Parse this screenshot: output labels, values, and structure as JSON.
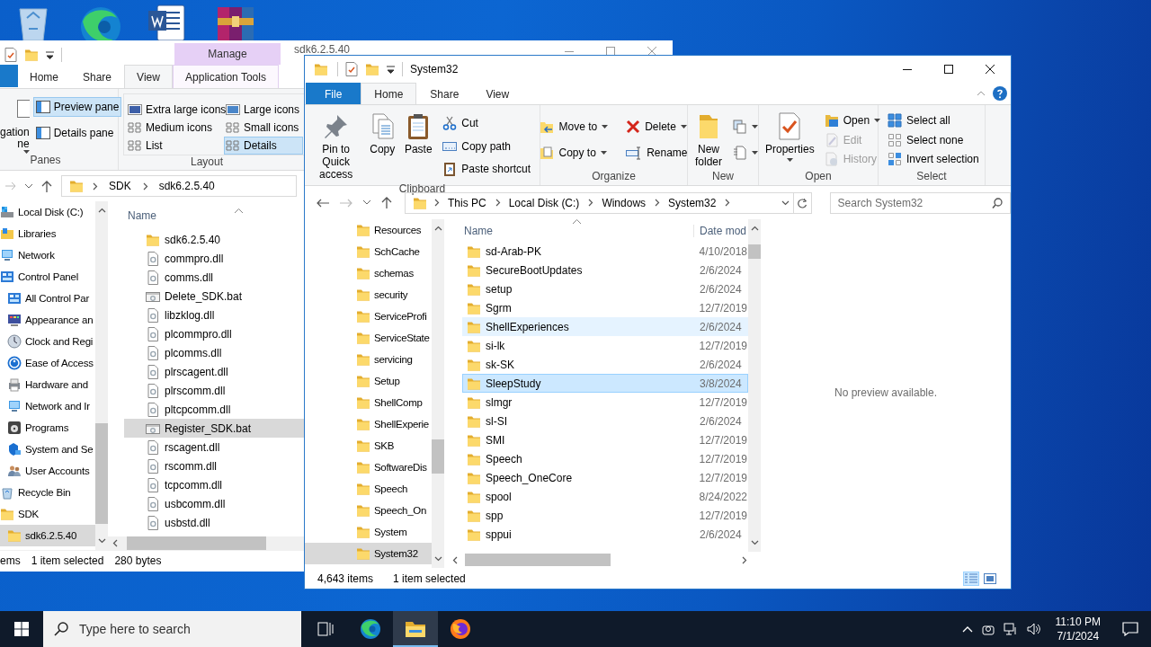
{
  "back_window": {
    "title": "sdk6.2.5.40",
    "context_group": "Manage",
    "tabs": [
      {
        "label": "Home",
        "selected": false
      },
      {
        "label": "Share",
        "selected": false
      },
      {
        "label": "View",
        "selected": true
      },
      {
        "label": "Application Tools",
        "selected": false
      }
    ],
    "panes": {
      "label": "Panes",
      "navigation_pane": [
        "gation",
        "ne"
      ],
      "buttons": [
        {
          "label": "Preview pane",
          "selected": true
        },
        {
          "label": "Details pane",
          "selected": false
        }
      ]
    },
    "layout": {
      "label": "Layout",
      "options": [
        {
          "label": "Extra large icons",
          "selected": false
        },
        {
          "label": "Large icons",
          "selected": false
        },
        {
          "label": "Medium icons",
          "selected": false
        },
        {
          "label": "Small icons",
          "selected": false
        },
        {
          "label": "List",
          "selected": false
        },
        {
          "label": "Details",
          "selected": true
        }
      ]
    },
    "breadcrumb": [
      "SDK",
      "sdk6.2.5.40"
    ],
    "nav_tree": [
      {
        "label": "Local Disk (C:)",
        "kind": "drive",
        "selected": false
      },
      {
        "label": "Libraries",
        "kind": "library",
        "selected": false
      },
      {
        "label": "Network",
        "kind": "network",
        "selected": false
      },
      {
        "label": "Control Panel",
        "kind": "control",
        "selected": false,
        "children": [
          {
            "label": "All Control Par",
            "kind": "control",
            "selected": false
          },
          {
            "label": "Appearance an",
            "kind": "applet",
            "selected": false
          },
          {
            "label": "Clock and Regi",
            "kind": "clock",
            "selected": false
          },
          {
            "label": "Ease of Access",
            "kind": "access",
            "selected": false
          },
          {
            "label": "Hardware and",
            "kind": "hardware",
            "selected": false
          },
          {
            "label": "Network and Ir",
            "kind": "network",
            "selected": false
          },
          {
            "label": "Programs",
            "kind": "programs",
            "selected": false
          },
          {
            "label": "System and Se",
            "kind": "shield",
            "selected": false
          },
          {
            "label": "User Accounts",
            "kind": "users",
            "selected": false
          }
        ]
      },
      {
        "label": "Recycle Bin",
        "kind": "recycle",
        "selected": false
      },
      {
        "label": "SDK",
        "kind": "folder",
        "selected": false,
        "children": [
          {
            "label": "sdk6.2.5.40",
            "kind": "folder",
            "selected": true
          }
        ]
      }
    ],
    "column": "Name",
    "files": [
      {
        "name": "sdk6.2.5.40",
        "kind": "folder",
        "selected": false
      },
      {
        "name": "commpro.dll",
        "kind": "dll",
        "selected": false
      },
      {
        "name": "comms.dll",
        "kind": "dll",
        "selected": false
      },
      {
        "name": "Delete_SDK.bat",
        "kind": "bat",
        "selected": false
      },
      {
        "name": "libzklog.dll",
        "kind": "dll",
        "selected": false
      },
      {
        "name": "plcommpro.dll",
        "kind": "dll",
        "selected": false
      },
      {
        "name": "plcomms.dll",
        "kind": "dll",
        "selected": false
      },
      {
        "name": "plrscagent.dll",
        "kind": "dll",
        "selected": false
      },
      {
        "name": "plrscomm.dll",
        "kind": "dll",
        "selected": false
      },
      {
        "name": "pltcpcomm.dll",
        "kind": "dll",
        "selected": false
      },
      {
        "name": "Register_SDK.bat",
        "kind": "bat",
        "selected": true
      },
      {
        "name": "rscagent.dll",
        "kind": "dll",
        "selected": false
      },
      {
        "name": "rscomm.dll",
        "kind": "dll",
        "selected": false
      },
      {
        "name": "tcpcomm.dll",
        "kind": "dll",
        "selected": false
      },
      {
        "name": "usbcomm.dll",
        "kind": "dll",
        "selected": false
      },
      {
        "name": "usbstd.dll",
        "kind": "dll",
        "selected": false
      }
    ],
    "status_bar": [
      "ems",
      "1 item selected",
      "280 bytes"
    ]
  },
  "front_window": {
    "title": "System32",
    "tabs": [
      {
        "label": "File",
        "kind": "file",
        "selected": false
      },
      {
        "label": "Home",
        "kind": "tab",
        "selected": true
      },
      {
        "label": "Share",
        "kind": "tab",
        "selected": false
      },
      {
        "label": "View",
        "kind": "tab",
        "selected": false
      }
    ],
    "ribbon": [
      {
        "label": "Clipboard",
        "buttons": [
          {
            "label": "Pin to Quick access",
            "kind": "large"
          },
          {
            "label": "Copy",
            "kind": "large"
          },
          {
            "label": "Paste",
            "kind": "large"
          },
          {
            "label": "Cut",
            "kind": "small"
          },
          {
            "label": "Copy path",
            "kind": "small"
          },
          {
            "label": "Paste shortcut",
            "kind": "small"
          }
        ]
      },
      {
        "label": "Organize",
        "buttons": [
          {
            "label": "Move to",
            "kind": "small",
            "dropdown": true
          },
          {
            "label": "Copy to",
            "kind": "small",
            "dropdown": true
          },
          {
            "label": "Delete",
            "kind": "small",
            "dropdown": true
          },
          {
            "label": "Rename",
            "kind": "small"
          }
        ]
      },
      {
        "label": "New",
        "buttons": [
          {
            "label": "New folder",
            "kind": "large"
          },
          {
            "kind": "small",
            "dropdown": true
          },
          {
            "kind": "small",
            "dropdown": true
          }
        ]
      },
      {
        "label": "Open",
        "buttons": [
          {
            "label": "Properties",
            "kind": "large",
            "dropdown": true
          },
          {
            "label": "Open",
            "kind": "small",
            "dropdown": true
          },
          {
            "label": "Edit",
            "kind": "small",
            "disabled": true
          },
          {
            "label": "History",
            "kind": "small",
            "disabled": true
          }
        ]
      },
      {
        "label": "Select",
        "buttons": [
          {
            "label": "Select all",
            "kind": "small"
          },
          {
            "label": "Select none",
            "kind": "small"
          },
          {
            "label": "Invert selection",
            "kind": "small"
          }
        ]
      }
    ],
    "breadcrumb": [
      "This PC",
      "Local Disk (C:)",
      "Windows",
      "System32"
    ],
    "search": {
      "placeholder": "Search System32"
    },
    "nav_folders": [
      {
        "label": "Resources",
        "selected": false
      },
      {
        "label": "SchCache",
        "selected": false
      },
      {
        "label": "schemas",
        "selected": false
      },
      {
        "label": "security",
        "selected": false
      },
      {
        "label": "ServiceProfi",
        "selected": false
      },
      {
        "label": "ServiceState",
        "selected": false
      },
      {
        "label": "servicing",
        "selected": false
      },
      {
        "label": "Setup",
        "selected": false
      },
      {
        "label": "ShellComp",
        "selected": false
      },
      {
        "label": "ShellExperie",
        "selected": false
      },
      {
        "label": "SKB",
        "selected": false
      },
      {
        "label": "SoftwareDis",
        "selected": false
      },
      {
        "label": "Speech",
        "selected": false
      },
      {
        "label": "Speech_On",
        "selected": false
      },
      {
        "label": "System",
        "selected": false
      },
      {
        "label": "System32",
        "selected": true
      }
    ],
    "columns": [
      "Name",
      "Date mod"
    ],
    "files": [
      {
        "name": "sd-Arab-PK",
        "date": "4/10/2018",
        "selected": false,
        "hovered": false
      },
      {
        "name": "SecureBootUpdates",
        "date": "2/6/2024",
        "selected": false,
        "hovered": false
      },
      {
        "name": "setup",
        "date": "2/6/2024",
        "selected": false,
        "hovered": false
      },
      {
        "name": "Sgrm",
        "date": "12/7/2019",
        "selected": false,
        "hovered": false
      },
      {
        "name": "ShellExperiences",
        "date": "2/6/2024",
        "selected": false,
        "hovered": true
      },
      {
        "name": "si-lk",
        "date": "12/7/2019",
        "selected": false,
        "hovered": false
      },
      {
        "name": "sk-SK",
        "date": "2/6/2024",
        "selected": false,
        "hovered": false
      },
      {
        "name": "SleepStudy",
        "date": "3/8/2024",
        "selected": true,
        "hovered": false
      },
      {
        "name": "slmgr",
        "date": "12/7/2019",
        "selected": false,
        "hovered": false
      },
      {
        "name": "sl-SI",
        "date": "2/6/2024",
        "selected": false,
        "hovered": false
      },
      {
        "name": "SMI",
        "date": "12/7/2019",
        "selected": false,
        "hovered": false
      },
      {
        "name": "Speech",
        "date": "12/7/2019",
        "selected": false,
        "hovered": false
      },
      {
        "name": "Speech_OneCore",
        "date": "12/7/2019",
        "selected": false,
        "hovered": false
      },
      {
        "name": "spool",
        "date": "8/24/2022",
        "selected": false,
        "hovered": false
      },
      {
        "name": "spp",
        "date": "12/7/2019",
        "selected": false,
        "hovered": false
      },
      {
        "name": "sppui",
        "date": "2/6/2024",
        "selected": false,
        "hovered": false
      }
    ],
    "preview_message": "No preview available.",
    "status_bar": [
      "4,643 items",
      "1 item selected"
    ],
    "view_buttons": [
      {
        "selected": true
      },
      {
        "selected": false
      }
    ]
  },
  "taskbar": {
    "search_placeholder": "Type here to search",
    "time": "11:10 PM",
    "date": "7/1/2024"
  }
}
